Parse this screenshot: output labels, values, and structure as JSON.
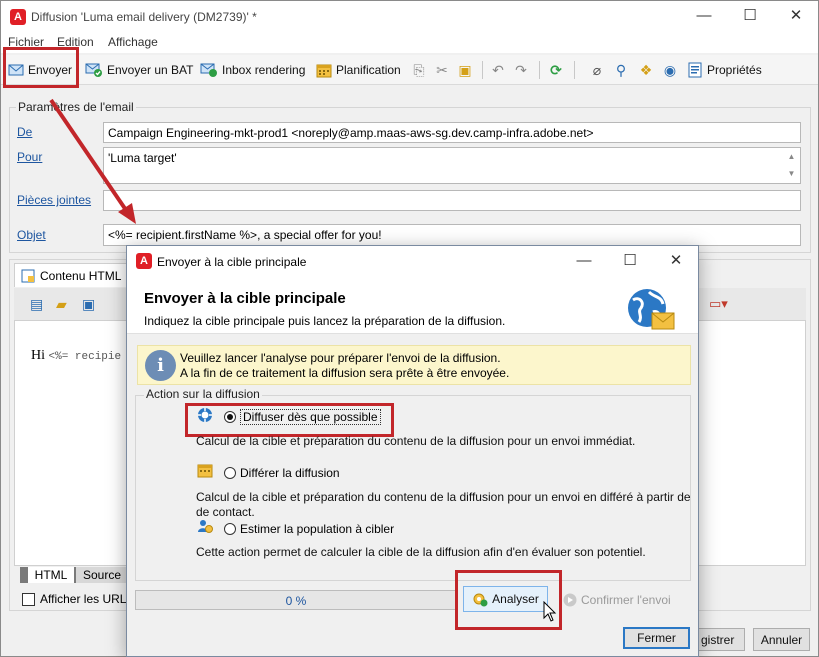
{
  "window": {
    "title": "Diffusion 'Luma email delivery (DM2739)' *",
    "controls": {
      "minimize": "—",
      "maximize": "☐",
      "close": "✕"
    }
  },
  "menu": [
    "Fichier",
    "Edition",
    "Affichage"
  ],
  "toolbar": {
    "send": "Envoyer",
    "send_proof": "Envoyer un BAT",
    "inbox_rendering": "Inbox rendering",
    "schedule": "Planification",
    "properties": "Propriétés"
  },
  "email_params": {
    "legend": "Paramètres de l'email",
    "fields": [
      {
        "label": "De",
        "value": "Campaign Engineering-mkt-prod1 <noreply@amp.maas-aws-sg.dev.camp-infra.adobe.net>"
      },
      {
        "label": "Pour",
        "value": "'Luma target'"
      },
      {
        "label": "Pièces jointes",
        "value": ""
      },
      {
        "label": "Objet",
        "value": "<%= recipient.firstName %>, a special offer for you!"
      }
    ]
  },
  "content": {
    "tab_label": "Contenu HTML",
    "editor_text_prefix": "Hi ",
    "editor_text_code": "<%= recipie",
    "bottom_tabs": [
      "HTML",
      "Source"
    ],
    "show_urls_label": "Afficher les URL",
    "save_label": "gistrer",
    "cancel_label": "Annuler"
  },
  "dialog": {
    "title": "Envoyer à la cible principale",
    "controls": {
      "minimize": "—",
      "maximize": "☐",
      "close": "✕"
    },
    "header_title": "Envoyer à la cible principale",
    "header_subtitle": "Indiquez la cible principale puis lancez la préparation de la diffusion.",
    "info_line1": "Veuillez lancer l'analyse pour préparer l'envoi de la diffusion.",
    "info_line2": "A la fin de ce traitement la diffusion sera prête à être envoyée.",
    "group_legend": "Action sur la diffusion",
    "options": [
      {
        "label": "Diffuser dès que possible",
        "checked": true,
        "description": "Calcul de la cible et préparation du contenu de la diffusion pour un envoi immédiat."
      },
      {
        "label": "Différer la diffusion",
        "checked": false,
        "description_line1": "Calcul de la cible et préparation du contenu de la diffusion pour un envoi en différé à partir de",
        "description_line2": "de contact."
      },
      {
        "label": "Estimer la population à cibler",
        "checked": false,
        "description": "Cette action permet de calculer la cible de la diffusion afin d'en évaluer son potentiel."
      }
    ],
    "progress_text": "0 %",
    "progress_value": 0,
    "analyze_button": "Analyser",
    "confirm_button": "Confirmer l'envoi",
    "close_button": "Fermer"
  },
  "colors": {
    "highlight": "#c2262a",
    "link": "#1e56a0",
    "brand": "#e01f26",
    "info_bg": "#fcf6cc"
  }
}
